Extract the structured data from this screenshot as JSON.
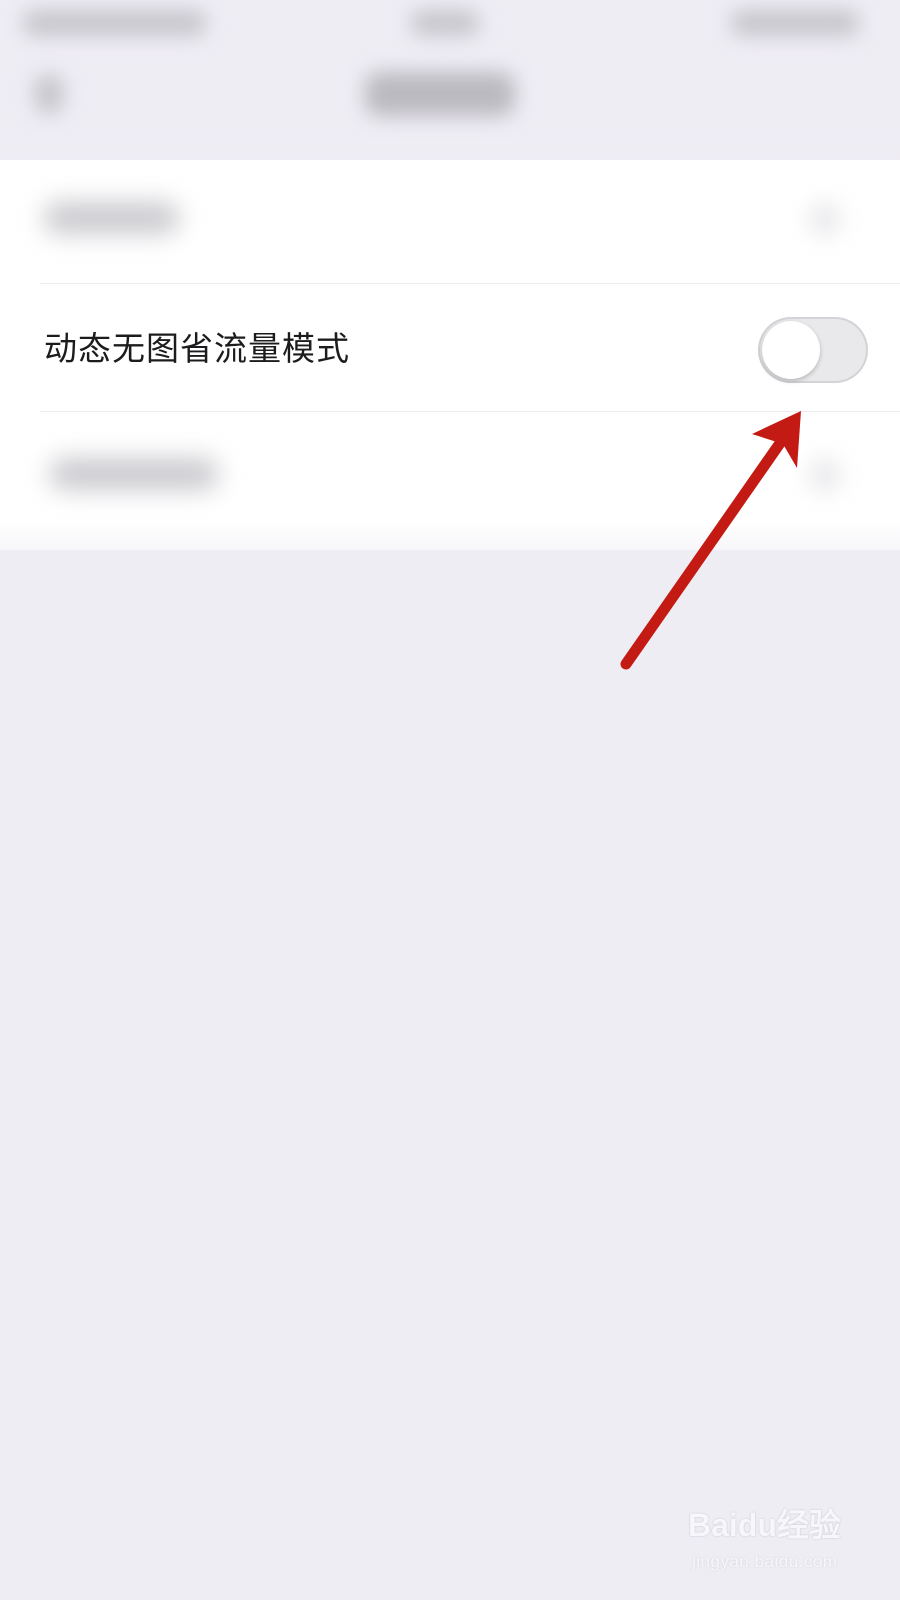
{
  "settings": {
    "data_saver_label": "动态无图省流量模式",
    "data_saver_enabled": false
  },
  "watermark": {
    "logo_text": "Baidu经验",
    "url": "jingyan.baidu.com"
  },
  "colors": {
    "background": "#efedf4",
    "card": "#ffffff",
    "toggle_off": "#e9e9ec",
    "annotation_arrow": "#c41a14"
  }
}
